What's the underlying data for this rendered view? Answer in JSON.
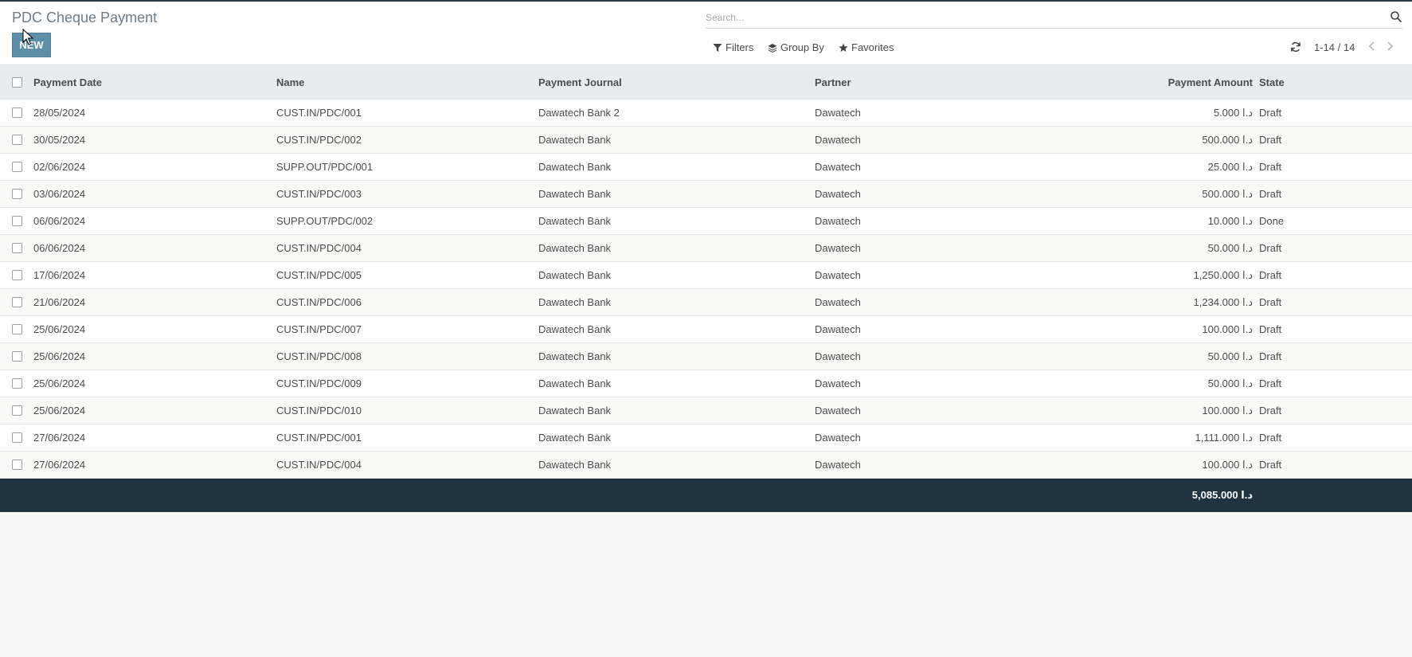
{
  "page": {
    "title": "PDC Cheque Payment",
    "new_label": "NEW"
  },
  "search": {
    "placeholder": "Search..."
  },
  "toolbar": {
    "filters_label": "Filters",
    "group_by_label": "Group By",
    "favorites_label": "Favorites"
  },
  "pager": {
    "text": "1-14 / 14"
  },
  "table": {
    "headers": {
      "date": "Payment Date",
      "name": "Name",
      "journal": "Payment Journal",
      "partner": "Partner",
      "amount": "Payment Amount",
      "state": "State"
    },
    "rows": [
      {
        "date": "28/05/2024",
        "name": "CUST.IN/PDC/001",
        "journal": "Dawatech Bank 2",
        "partner": "Dawatech",
        "amount": "5.000 د.ا",
        "state": "Draft"
      },
      {
        "date": "30/05/2024",
        "name": "CUST.IN/PDC/002",
        "journal": "Dawatech Bank",
        "partner": "Dawatech",
        "amount": "500.000 د.ا",
        "state": "Draft"
      },
      {
        "date": "02/06/2024",
        "name": "SUPP.OUT/PDC/001",
        "journal": "Dawatech Bank",
        "partner": "Dawatech",
        "amount": "25.000 د.ا",
        "state": "Draft"
      },
      {
        "date": "03/06/2024",
        "name": "CUST.IN/PDC/003",
        "journal": "Dawatech Bank",
        "partner": "Dawatech",
        "amount": "500.000 د.ا",
        "state": "Draft"
      },
      {
        "date": "06/06/2024",
        "name": "SUPP.OUT/PDC/002",
        "journal": "Dawatech Bank",
        "partner": "Dawatech",
        "amount": "10.000 د.ا",
        "state": "Done"
      },
      {
        "date": "06/06/2024",
        "name": "CUST.IN/PDC/004",
        "journal": "Dawatech Bank",
        "partner": "Dawatech",
        "amount": "50.000 د.ا",
        "state": "Draft"
      },
      {
        "date": "17/06/2024",
        "name": "CUST.IN/PDC/005",
        "journal": "Dawatech Bank",
        "partner": "Dawatech",
        "amount": "1,250.000 د.ا",
        "state": "Draft"
      },
      {
        "date": "21/06/2024",
        "name": "CUST.IN/PDC/006",
        "journal": "Dawatech Bank",
        "partner": "Dawatech",
        "amount": "1,234.000 د.ا",
        "state": "Draft"
      },
      {
        "date": "25/06/2024",
        "name": "CUST.IN/PDC/007",
        "journal": "Dawatech Bank",
        "partner": "Dawatech",
        "amount": "100.000 د.ا",
        "state": "Draft"
      },
      {
        "date": "25/06/2024",
        "name": "CUST.IN/PDC/008",
        "journal": "Dawatech Bank",
        "partner": "Dawatech",
        "amount": "50.000 د.ا",
        "state": "Draft"
      },
      {
        "date": "25/06/2024",
        "name": "CUST.IN/PDC/009",
        "journal": "Dawatech Bank",
        "partner": "Dawatech",
        "amount": "50.000 د.ا",
        "state": "Draft"
      },
      {
        "date": "25/06/2024",
        "name": "CUST.IN/PDC/010",
        "journal": "Dawatech Bank",
        "partner": "Dawatech",
        "amount": "100.000 د.ا",
        "state": "Draft"
      },
      {
        "date": "27/06/2024",
        "name": "CUST.IN/PDC/001",
        "journal": "Dawatech Bank",
        "partner": "Dawatech",
        "amount": "1,111.000 د.ا",
        "state": "Draft"
      },
      {
        "date": "27/06/2024",
        "name": "CUST.IN/PDC/004",
        "journal": "Dawatech Bank",
        "partner": "Dawatech",
        "amount": "100.000 د.ا",
        "state": "Draft"
      }
    ],
    "total": "5,085.000 د.ا"
  },
  "colors": {
    "new_button": "#5d8fa8",
    "footer_bg": "#1f3340",
    "header_bg": "#e9ecef"
  }
}
